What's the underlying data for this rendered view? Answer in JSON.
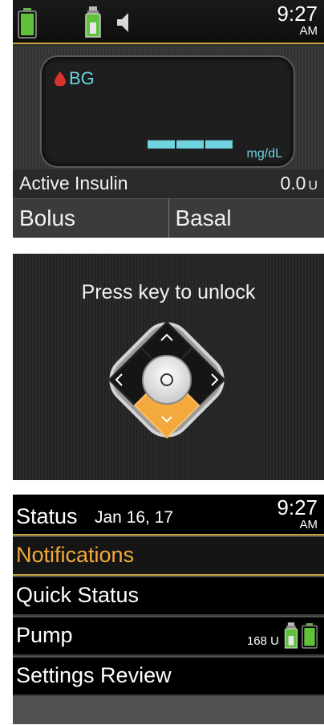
{
  "home": {
    "time": "9:27",
    "ampm": "AM",
    "bg_label": "BG",
    "bg_value": "▬▬▬",
    "bg_unit": "mg/dL",
    "active_insulin_label": "Active Insulin",
    "active_insulin_value": "0.0",
    "active_insulin_unit": "U",
    "tab_bolus": "Bolus",
    "tab_basal": "Basal"
  },
  "lock": {
    "message": "Press key to unlock",
    "keys": [
      "chevron-up-icon",
      "chevron-left-icon",
      "circle-icon",
      "chevron-right-icon",
      "chevron-down-icon"
    ]
  },
  "status": {
    "title": "Status",
    "date": "Jan 16, 17",
    "time": "9:27",
    "ampm": "AM",
    "items": [
      {
        "label": "Notifications"
      },
      {
        "label": "Quick Status"
      },
      {
        "label": "Pump",
        "reservoir": "168 U"
      },
      {
        "label": "Settings Review"
      }
    ]
  },
  "colors": {
    "accent": "#c8a23c",
    "selected_text": "#f3a93b",
    "bg_text": "#6fd3e0",
    "battery": "#5fc23a",
    "drop": "#d9342b",
    "down_key": "#f3a93b"
  },
  "icons": {
    "battery": "battery-icon",
    "insulin": "insulin-vial-icon",
    "sound": "speaker-icon",
    "blood": "blood-drop-icon"
  }
}
